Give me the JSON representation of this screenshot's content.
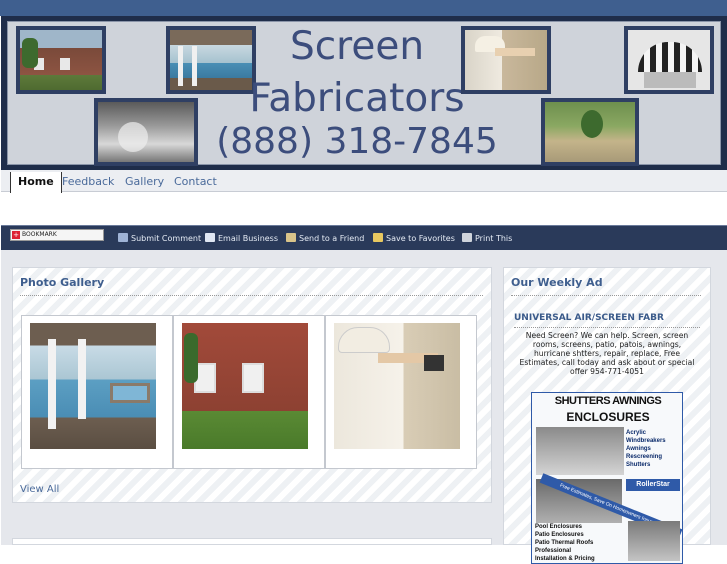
{
  "header": {
    "title_line1": "Screen",
    "title_line2": "Fabricators",
    "phone": "(888) 318-7845"
  },
  "nav": {
    "tabs": [
      {
        "label": "Home",
        "active": true
      },
      {
        "label": "Feedback",
        "active": false
      },
      {
        "label": "Gallery",
        "active": false
      },
      {
        "label": "Contact",
        "active": false
      }
    ]
  },
  "toolbar": {
    "bookmark": "BOOKMARK",
    "items": [
      "Submit Comment",
      "Email Business",
      "Send to a Friend",
      "Save to Favorites",
      "Print This"
    ]
  },
  "gallery": {
    "title": "Photo Gallery",
    "view_all": "View All"
  },
  "weekly_ad": {
    "title": "Our Weekly Ad",
    "headline": "UNIVERSAL AIR/SCREEN FABR",
    "body": "Need Screen? We can help. Screen, screen rooms, screens, patio, patois, awnings, hurricane shtters, repair, replace, Free Estimates, call today and ask about or special offer 954-771-4051",
    "flyer": {
      "headline1": "SHUTTERS AWNINGS",
      "headline2": "ENCLOSURES",
      "list_top": [
        "Acrylic",
        "Windbreakers",
        "Awnings",
        "Rescreening",
        "Shutters"
      ],
      "brand": "RollerStar",
      "banner": "Free Estimates, Save On Homeowners Insurance",
      "list_bottom": [
        "Pool Enclosures",
        "Patio Enclosures",
        "Patio Thermal Roofs",
        "Professional",
        "Installation & Pricing"
      ]
    }
  },
  "colors": {
    "accent": "#3e5e8e",
    "nav_link": "#4a6a9a",
    "toolbar_bg": "#2a3a5a",
    "banner_frame": "#1f2d4a"
  }
}
